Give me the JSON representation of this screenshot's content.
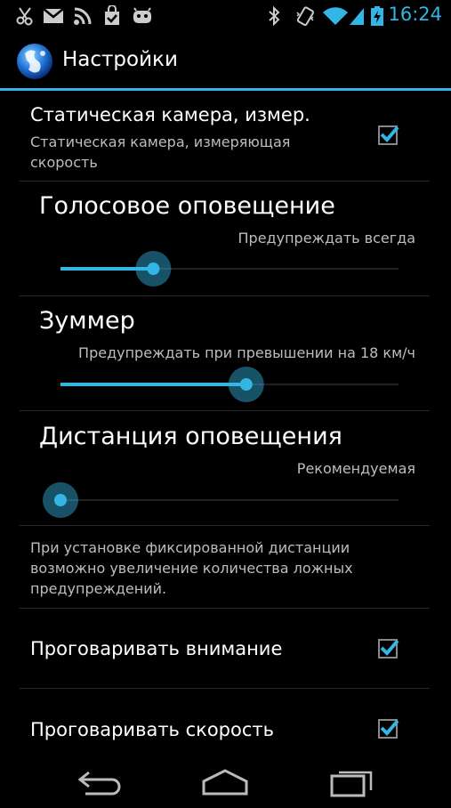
{
  "status_bar": {
    "time": "16:24",
    "icons": [
      "scissors-icon",
      "gmail-icon",
      "rss-icon",
      "shopping-bag-icon",
      "android-icon",
      "bluetooth-icon",
      "vibrate-icon",
      "wifi-icon",
      "signal-icon",
      "battery-charging-icon"
    ]
  },
  "action_bar": {
    "title": "Настройки"
  },
  "prefs": {
    "static_camera": {
      "title": "Статическая камера, измер.",
      "summary": "Статическая камера, измеряющая скорость",
      "checked": true
    },
    "voice_alert": {
      "title": "Голосовое оповещение",
      "value": "Предупреждать всегда",
      "level": 0.29
    },
    "buzzer": {
      "title": "Зуммер",
      "value": "Предупреждать при превышении на  18 км/ч",
      "level": 0.58
    },
    "alert_distance": {
      "title": "Дистанция оповещения",
      "value": "Рекомендуемая",
      "level": 0.0
    },
    "note": "При установке фиксированной дистанции возможно увеличение количества ложных предупреждений.",
    "speak_attention": {
      "title": "Проговаривать внимание",
      "checked": true
    },
    "speak_speed": {
      "title": "Проговаривать скорость",
      "checked": true
    }
  },
  "nav_bar": {
    "buttons": [
      "back-icon",
      "home-icon",
      "recent-apps-icon"
    ]
  },
  "colors": {
    "accent": "#33b5e5",
    "background": "#000000"
  }
}
